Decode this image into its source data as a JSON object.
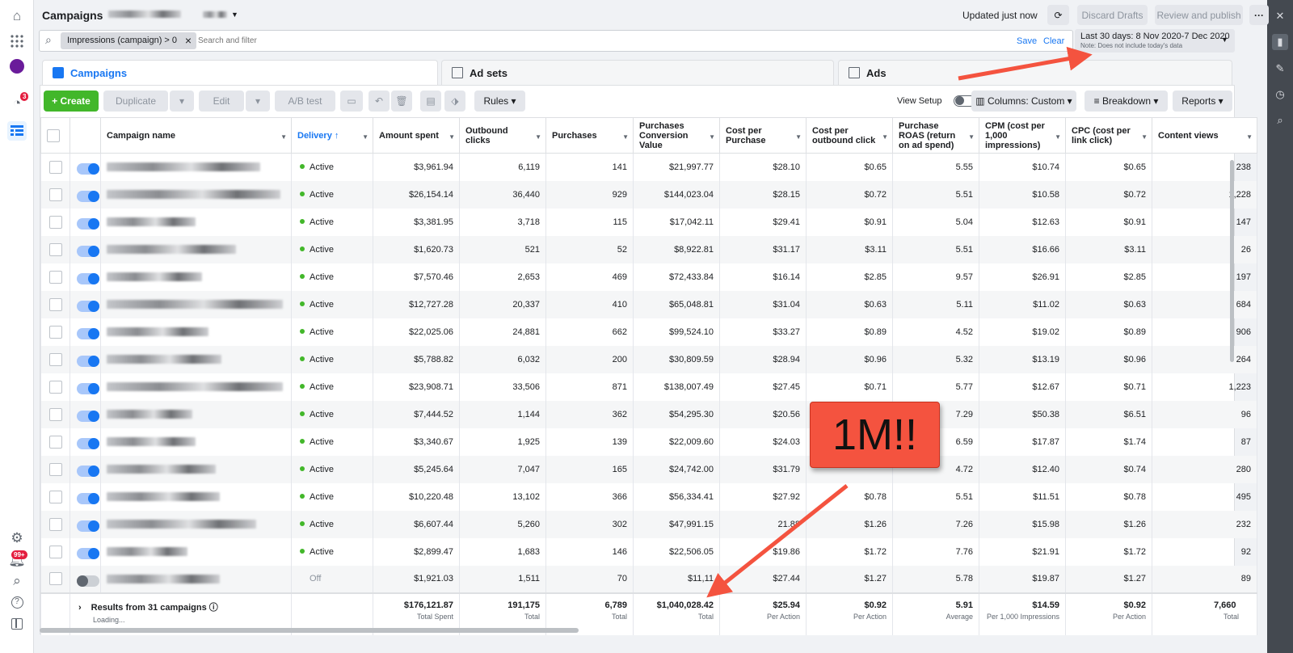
{
  "header": {
    "title": "Campaigns",
    "updated": "Updated just now",
    "discard_label": "Discard Drafts",
    "review_label": "Review and publish",
    "more_label": "···"
  },
  "filter": {
    "chip_label": "Impressions (campaign) > 0",
    "placeholder": "Search and filter",
    "save_label": "Save",
    "clear_label": "Clear"
  },
  "date_range": {
    "label": "Last 30 days: 8 Nov 2020-7 Dec 2020",
    "note": "Note: Does not include today's data"
  },
  "tabs": [
    {
      "label": "Campaigns"
    },
    {
      "label": "Ad sets"
    },
    {
      "label": "Ads"
    }
  ],
  "toolbar": {
    "create": "+ Create",
    "duplicate": "Duplicate",
    "edit": "Edit",
    "ab_test": "A/B test",
    "rules": "Rules",
    "view_setup": "View Setup",
    "columns": "Columns: Custom",
    "breakdown": "Breakdown",
    "reports": "Reports"
  },
  "notifications": {
    "badge": "3",
    "alerts": "99+"
  },
  "columns": [
    "Campaign name",
    "Delivery ↑",
    "Amount spent",
    "Outbound clicks",
    "Purchases",
    "Purchases Conversion Value",
    "Cost per Purchase",
    "Cost per outbound click",
    "Purchase ROAS (return on ad spend)",
    "CPM (cost per 1,000 impressions)",
    "CPC (cost per link click)",
    "Content views"
  ],
  "rows": [
    {
      "delivery": "Active",
      "spent": "$3,961.94",
      "clicks": "6,119",
      "purchases": "141",
      "value": "$21,997.77",
      "cpp": "$28.10",
      "cpoc": "$0.65",
      "roas": "5.55",
      "cpm": "$10.74",
      "cpc": "$0.65",
      "views": "238"
    },
    {
      "delivery": "Active",
      "spent": "$26,154.14",
      "clicks": "36,440",
      "purchases": "929",
      "value": "$144,023.04",
      "cpp": "$28.15",
      "cpoc": "$0.72",
      "roas": "5.51",
      "cpm": "$10.58",
      "cpc": "$0.72",
      "views": "1,228"
    },
    {
      "delivery": "Active",
      "spent": "$3,381.95",
      "clicks": "3,718",
      "purchases": "115",
      "value": "$17,042.11",
      "cpp": "$29.41",
      "cpoc": "$0.91",
      "roas": "5.04",
      "cpm": "$12.63",
      "cpc": "$0.91",
      "views": "147"
    },
    {
      "delivery": "Active",
      "spent": "$1,620.73",
      "clicks": "521",
      "purchases": "52",
      "value": "$8,922.81",
      "cpp": "$31.17",
      "cpoc": "$3.11",
      "roas": "5.51",
      "cpm": "$16.66",
      "cpc": "$3.11",
      "views": "26"
    },
    {
      "delivery": "Active",
      "spent": "$7,570.46",
      "clicks": "2,653",
      "purchases": "469",
      "value": "$72,433.84",
      "cpp": "$16.14",
      "cpoc": "$2.85",
      "roas": "9.57",
      "cpm": "$26.91",
      "cpc": "$2.85",
      "views": "197"
    },
    {
      "delivery": "Active",
      "spent": "$12,727.28",
      "clicks": "20,337",
      "purchases": "410",
      "value": "$65,048.81",
      "cpp": "$31.04",
      "cpoc": "$0.63",
      "roas": "5.11",
      "cpm": "$11.02",
      "cpc": "$0.63",
      "views": "684"
    },
    {
      "delivery": "Active",
      "spent": "$22,025.06",
      "clicks": "24,881",
      "purchases": "662",
      "value": "$99,524.10",
      "cpp": "$33.27",
      "cpoc": "$0.89",
      "roas": "4.52",
      "cpm": "$19.02",
      "cpc": "$0.89",
      "views": "906"
    },
    {
      "delivery": "Active",
      "spent": "$5,788.82",
      "clicks": "6,032",
      "purchases": "200",
      "value": "$30,809.59",
      "cpp": "$28.94",
      "cpoc": "$0.96",
      "roas": "5.32",
      "cpm": "$13.19",
      "cpc": "$0.96",
      "views": "264"
    },
    {
      "delivery": "Active",
      "spent": "$23,908.71",
      "clicks": "33,506",
      "purchases": "871",
      "value": "$138,007.49",
      "cpp": "$27.45",
      "cpoc": "$0.71",
      "roas": "5.77",
      "cpm": "$12.67",
      "cpc": "$0.71",
      "views": "1,223"
    },
    {
      "delivery": "Active",
      "spent": "$7,444.52",
      "clicks": "1,144",
      "purchases": "362",
      "value": "$54,295.30",
      "cpp": "$20.56",
      "cpoc": "",
      "roas": "7.29",
      "cpm": "$50.38",
      "cpc": "$6.51",
      "views": "96"
    },
    {
      "delivery": "Active",
      "spent": "$3,340.67",
      "clicks": "1,925",
      "purchases": "139",
      "value": "$22,009.60",
      "cpp": "$24.03",
      "cpoc": "",
      "roas": "6.59",
      "cpm": "$17.87",
      "cpc": "$1.74",
      "views": "87"
    },
    {
      "delivery": "Active",
      "spent": "$5,245.64",
      "clicks": "7,047",
      "purchases": "165",
      "value": "$24,742.00",
      "cpp": "$31.79",
      "cpoc": "",
      "roas": "4.72",
      "cpm": "$12.40",
      "cpc": "$0.74",
      "views": "280"
    },
    {
      "delivery": "Active",
      "spent": "$10,220.48",
      "clicks": "13,102",
      "purchases": "366",
      "value": "$56,334.41",
      "cpp": "$27.92",
      "cpoc": "$0.78",
      "roas": "5.51",
      "cpm": "$11.51",
      "cpc": "$0.78",
      "views": "495"
    },
    {
      "delivery": "Active",
      "spent": "$6,607.44",
      "clicks": "5,260",
      "purchases": "302",
      "value": "$47,991.15",
      "cpp": "21.88",
      "cpoc": "$1.26",
      "roas": "7.26",
      "cpm": "$15.98",
      "cpc": "$1.26",
      "views": "232"
    },
    {
      "delivery": "Active",
      "spent": "$2,899.47",
      "clicks": "1,683",
      "purchases": "146",
      "value": "$22,506.05",
      "cpp": "$19.86",
      "cpoc": "$1.72",
      "roas": "7.76",
      "cpm": "$21.91",
      "cpc": "$1.72",
      "views": "92"
    },
    {
      "delivery": "Off",
      "spent": "$1,921.03",
      "clicks": "1,511",
      "purchases": "70",
      "value": "$11,11",
      "cpp": "$27.44",
      "cpoc": "$1.27",
      "roas": "5.78",
      "cpm": "$19.87",
      "cpc": "$1.27",
      "views": "89"
    }
  ],
  "footer": {
    "results_label": "Results from 31 campaigns",
    "loading": "Loading...",
    "spent": {
      "value": "$176,121.87",
      "sub": "Total Spent"
    },
    "clicks": {
      "value": "191,175",
      "sub": "Total"
    },
    "purchases": {
      "value": "6,789",
      "sub": "Total"
    },
    "conv_value": {
      "value": "$1,040,028.42",
      "sub": "Total"
    },
    "cpp": {
      "value": "$25.94",
      "sub": "Per Action"
    },
    "cpoc": {
      "value": "$0.92",
      "sub": "Per Action"
    },
    "roas": {
      "value": "5.91",
      "sub": "Average"
    },
    "cpm": {
      "value": "$14.59",
      "sub": "Per 1,000 Impressions"
    },
    "cpc": {
      "value": "$0.92",
      "sub": "Per Action"
    },
    "views": {
      "value": "7,660",
      "sub": "Total"
    }
  },
  "annotation": {
    "text": "1M!!"
  },
  "colors": {
    "accent": "#1877f2",
    "create": "#42b72a",
    "annotation": "#f4533f"
  }
}
